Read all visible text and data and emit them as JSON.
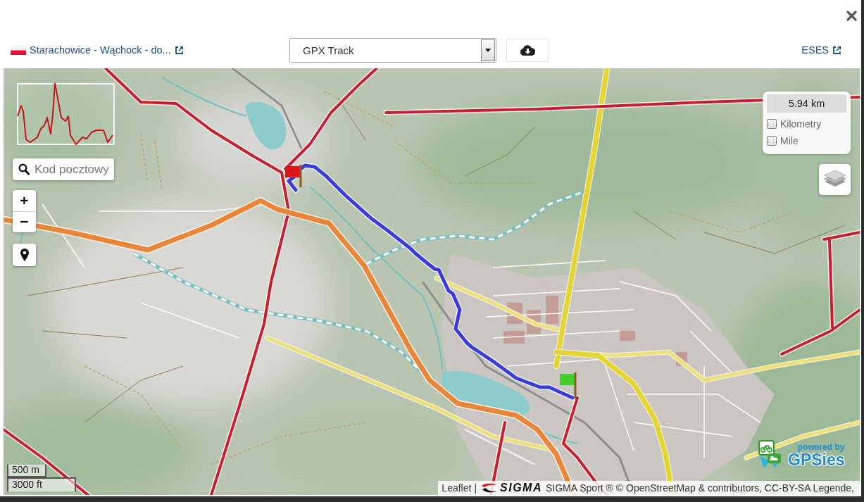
{
  "header": {
    "track_link": "Starachowice - Wąchock - do...",
    "track_select": {
      "value": "GPX Track"
    },
    "user_link": "ESES"
  },
  "map": {
    "search": {
      "placeholder": "Kod pocztowy"
    },
    "zoom": {
      "in": "+",
      "out": "−"
    },
    "distance_panel": {
      "total": "5.94 km",
      "options": [
        {
          "label": "Kilometry",
          "checked": false
        },
        {
          "label": "Mile",
          "checked": false
        }
      ]
    },
    "scale": [
      "500 m",
      "3000 ft"
    ],
    "logo": {
      "tagline": "powered by",
      "name": "GPSies"
    },
    "attribution": {
      "link": "Leaflet",
      "separator": "|",
      "logo_text": "SIGMA",
      "text": "SIGMA Sport ® © OpenStreetMap & contributors, CC-BY-SA Legende,"
    }
  }
}
